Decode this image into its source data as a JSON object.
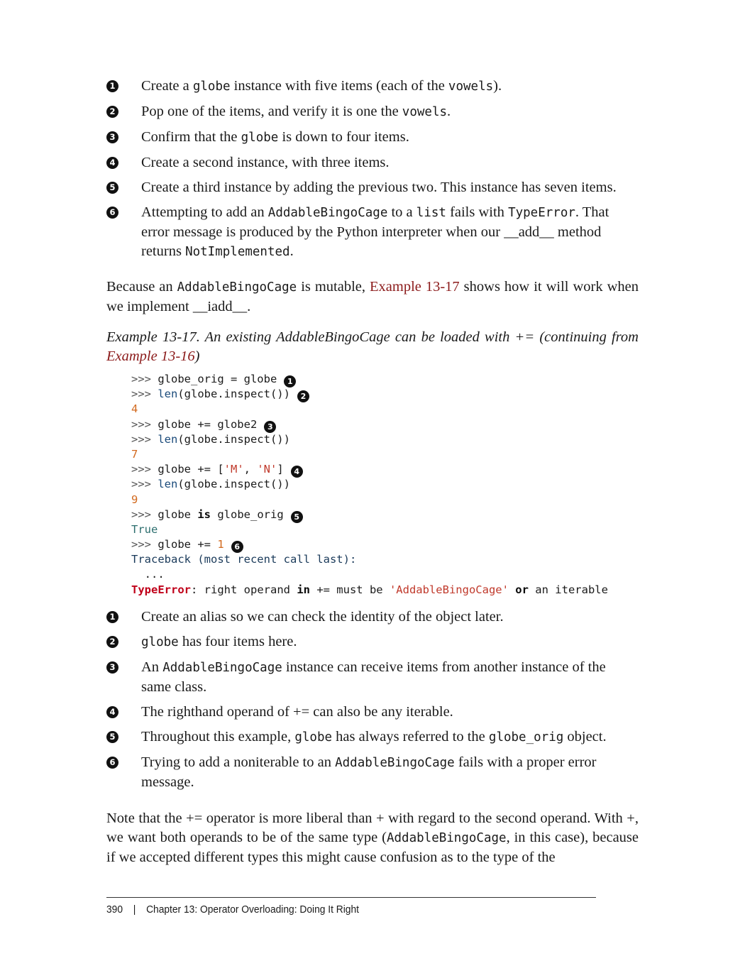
{
  "callouts_top": [
    {
      "n": "1",
      "parts": [
        {
          "t": "Create a "
        },
        {
          "c": "globe"
        },
        {
          "t": " instance with five items (each of the "
        },
        {
          "c": "vowels"
        },
        {
          "t": ")."
        }
      ]
    },
    {
      "n": "2",
      "parts": [
        {
          "t": "Pop one of the items, and verify it is one the "
        },
        {
          "c": "vowels"
        },
        {
          "t": "."
        }
      ]
    },
    {
      "n": "3",
      "parts": [
        {
          "t": "Confirm that the "
        },
        {
          "c": "globe"
        },
        {
          "t": " is down to four items."
        }
      ]
    },
    {
      "n": "4",
      "parts": [
        {
          "t": "Create a second instance, with three items."
        }
      ]
    },
    {
      "n": "5",
      "parts": [
        {
          "t": "Create a third instance by adding the previous two. This instance has seven items."
        }
      ]
    },
    {
      "n": "6",
      "parts": [
        {
          "t": "Attempting to add an "
        },
        {
          "c": "AddableBingoCage"
        },
        {
          "t": " to a "
        },
        {
          "c": "list"
        },
        {
          "t": " fails with "
        },
        {
          "c": "TypeError"
        },
        {
          "t": ". That error message is produced by the Python interpreter when our __add__ method returns "
        },
        {
          "c": "NotImplemented"
        },
        {
          "t": "."
        }
      ]
    }
  ],
  "para1": [
    {
      "t": "Because an "
    },
    {
      "c": "AddableBingoCage"
    },
    {
      "t": " is mutable, "
    },
    {
      "l": "Example 13-17"
    },
    {
      "t": " shows how it will work when we implement __iadd__."
    }
  ],
  "caption": {
    "text": "Example 13-17. An existing AddableBingoCage can be loaded with += (continuing from ",
    "link": "Example 13-16",
    "end": ")"
  },
  "code": [
    {
      "segs": [
        {
          "k": "prompt",
          "t": ">>> "
        },
        {
          "k": "plain",
          "t": "globe_orig = globe"
        }
      ],
      "mark": "1"
    },
    {
      "segs": [
        {
          "k": "prompt",
          "t": ">>> "
        },
        {
          "k": "fn",
          "t": "len"
        },
        {
          "k": "plain",
          "t": "(globe.inspect())"
        }
      ],
      "mark": "2"
    },
    {
      "segs": [
        {
          "k": "num-out",
          "t": "4"
        }
      ]
    },
    {
      "segs": [
        {
          "k": "prompt",
          "t": ">>> "
        },
        {
          "k": "plain",
          "t": "globe += globe2"
        }
      ],
      "mark": "3"
    },
    {
      "segs": [
        {
          "k": "prompt",
          "t": ">>> "
        },
        {
          "k": "fn",
          "t": "len"
        },
        {
          "k": "plain",
          "t": "(globe.inspect())"
        }
      ]
    },
    {
      "segs": [
        {
          "k": "num-out",
          "t": "7"
        }
      ]
    },
    {
      "segs": [
        {
          "k": "prompt",
          "t": ">>> "
        },
        {
          "k": "plain",
          "t": "globe += ["
        },
        {
          "k": "str",
          "t": "'M'"
        },
        {
          "k": "plain",
          "t": ", "
        },
        {
          "k": "str",
          "t": "'N'"
        },
        {
          "k": "plain",
          "t": "]"
        }
      ],
      "mark": "4"
    },
    {
      "segs": [
        {
          "k": "prompt",
          "t": ">>> "
        },
        {
          "k": "fn",
          "t": "len"
        },
        {
          "k": "plain",
          "t": "(globe.inspect())"
        }
      ]
    },
    {
      "segs": [
        {
          "k": "num-out",
          "t": "9"
        }
      ]
    },
    {
      "segs": [
        {
          "k": "prompt",
          "t": ">>> "
        },
        {
          "k": "plain",
          "t": "globe "
        },
        {
          "k": "kw",
          "t": "is"
        },
        {
          "k": "plain",
          "t": " globe_orig"
        }
      ],
      "mark": "5"
    },
    {
      "segs": [
        {
          "k": "true-out",
          "t": "True"
        }
      ]
    },
    {
      "segs": [
        {
          "k": "prompt",
          "t": ">>> "
        },
        {
          "k": "plain",
          "t": "globe += "
        },
        {
          "k": "num-out",
          "t": "1"
        }
      ],
      "mark": "6"
    },
    {
      "segs": [
        {
          "k": "tb",
          "t": "Traceback (most recent call last):"
        }
      ]
    },
    {
      "segs": [
        {
          "k": "plain",
          "t": "  ..."
        }
      ]
    },
    {
      "segs": [
        {
          "k": "err",
          "t": "TypeError"
        },
        {
          "k": "plain",
          "t": ": right operand "
        },
        {
          "k": "kw",
          "t": "in"
        },
        {
          "k": "plain",
          "t": " += must be "
        },
        {
          "k": "str",
          "t": "'AddableBingoCage'"
        },
        {
          "k": "plain",
          "t": " "
        },
        {
          "k": "kw",
          "t": "or"
        },
        {
          "k": "plain",
          "t": " an iterable"
        }
      ]
    }
  ],
  "callouts_bottom": [
    {
      "n": "1",
      "parts": [
        {
          "t": "Create an alias so we can check the identity of the object later."
        }
      ]
    },
    {
      "n": "2",
      "parts": [
        {
          "c": "globe"
        },
        {
          "t": " has four items here."
        }
      ]
    },
    {
      "n": "3",
      "parts": [
        {
          "t": "An "
        },
        {
          "c": "AddableBingoCage"
        },
        {
          "t": " instance can receive items from another instance of the same class."
        }
      ]
    },
    {
      "n": "4",
      "parts": [
        {
          "t": "The righthand operand of += can also be any iterable."
        }
      ]
    },
    {
      "n": "5",
      "parts": [
        {
          "t": "Throughout this example, "
        },
        {
          "c": "globe"
        },
        {
          "t": " has always referred to the "
        },
        {
          "c": "globe_orig"
        },
        {
          "t": " object."
        }
      ]
    },
    {
      "n": "6",
      "parts": [
        {
          "t": "Trying to add a noniterable to an "
        },
        {
          "c": "AddableBingoCage"
        },
        {
          "t": " fails with a proper error message."
        }
      ]
    }
  ],
  "para2": [
    {
      "t": "Note that the += operator is more liberal than + with regard to the second operand. With +, we want both operands to be of the same type ("
    },
    {
      "c": "AddableBingoCage"
    },
    {
      "t": ", in this case), because if we accepted different types this might cause confusion as to the type of the"
    }
  ],
  "footer": {
    "page": "390",
    "sep": "|",
    "chapter": "Chapter 13: Operator Overloading: Doing It Right"
  }
}
